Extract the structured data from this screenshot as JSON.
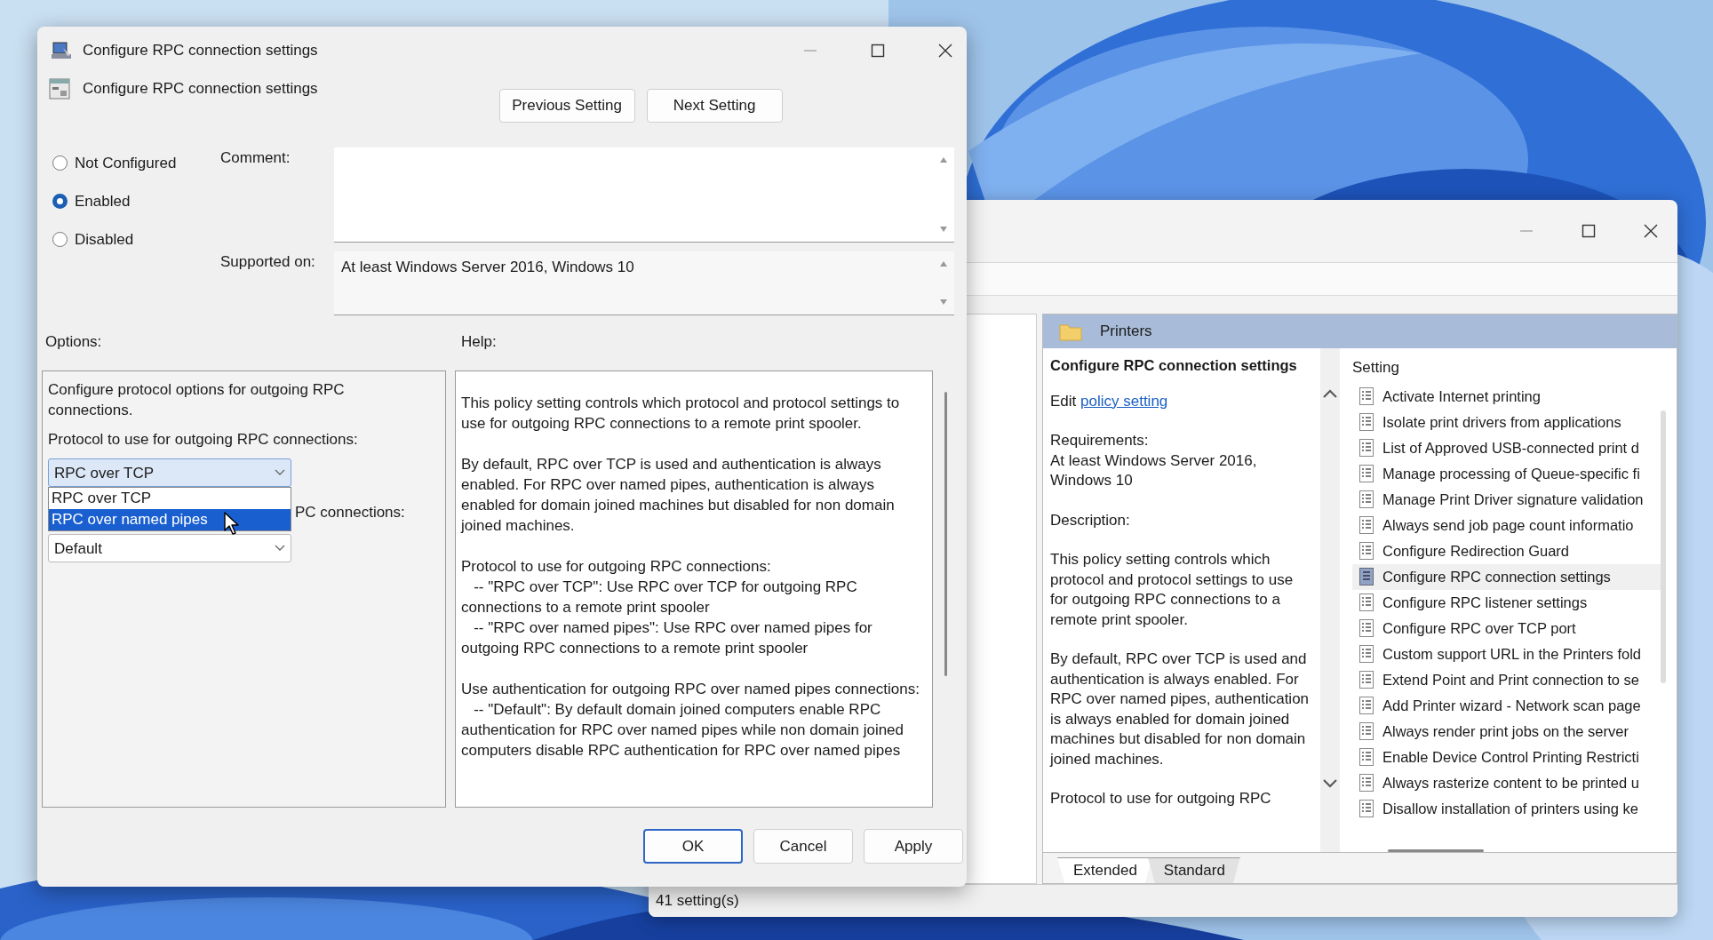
{
  "dialog": {
    "title": "Configure RPC connection settings",
    "heading": "Configure RPC connection settings",
    "nav_buttons": [
      "Previous Setting",
      "Next Setting"
    ],
    "states": [
      {
        "label": "Not Configured",
        "selected": false
      },
      {
        "label": "Enabled",
        "selected": true
      },
      {
        "label": "Disabled",
        "selected": false
      }
    ],
    "comment": {
      "label": "Comment:"
    },
    "supported_on": {
      "label": "Supported on:",
      "value": "At least Windows Server 2016, Windows 10"
    },
    "options": {
      "label": "Options:",
      "intro": "Configure protocol options for outgoing RPC connections.",
      "protocol_label": "Protocol to use for outgoing RPC connections:",
      "protocol_dropdown": {
        "value": "RPC over TCP",
        "expanded": true,
        "options": [
          {
            "label": "RPC over TCP",
            "highlighted": false
          },
          {
            "label": "RPC over named pipes",
            "highlighted": true
          }
        ]
      },
      "auth_label": "PC connections:",
      "auth_dropdown": {
        "value": "Default"
      }
    },
    "help": {
      "label": "Help:",
      "paragraphs": [
        "This policy setting controls which protocol and protocol settings to use for outgoing RPC connections to a remote print spooler.",
        "By default, RPC over TCP is used and authentication is always enabled. For RPC over named pipes, authentication is always enabled for domain joined machines but disabled for non domain joined machines.",
        "Protocol to use for outgoing RPC connections:\n   -- \"RPC over TCP\": Use RPC over TCP for outgoing RPC connections to a remote print spooler\n   -- \"RPC over named pipes\": Use RPC over named pipes for outgoing RPC connections to a remote print spooler",
        "Use authentication for outgoing RPC over named pipes connections:\n   -- \"Default\": By default domain joined computers enable RPC authentication for RPC over named pipes while non domain joined computers disable RPC authentication for RPC over named pipes"
      ]
    },
    "buttons": [
      "OK",
      "Cancel",
      "Apply"
    ]
  },
  "editor": {
    "pane_title": "Printers",
    "detail": {
      "title": "Configure RPC connection settings",
      "edit_prefix": "Edit",
      "edit_link": "policy setting",
      "requirements_label": "Requirements:",
      "requirements": "At least Windows Server 2016, Windows 10",
      "description_label": "Description:",
      "description": [
        "This policy setting controls which protocol and protocol settings to use for outgoing RPC connections to a remote print spooler.",
        "By default, RPC over TCP is used and authentication is always enabled. For RPC over named pipes, authentication is always enabled for domain joined machines but disabled for non domain joined machines.",
        "Protocol to use for outgoing RPC"
      ]
    },
    "list": {
      "column": "Setting",
      "items": [
        {
          "label": "Activate Internet printing",
          "selected": false
        },
        {
          "label": "Isolate print drivers from applications",
          "selected": false
        },
        {
          "label": "List of Approved USB-connected print d",
          "selected": false
        },
        {
          "label": "Manage processing of Queue-specific fi",
          "selected": false
        },
        {
          "label": "Manage Print Driver signature validation",
          "selected": false
        },
        {
          "label": "Always send job page count informatio",
          "selected": false
        },
        {
          "label": "Configure Redirection Guard",
          "selected": false
        },
        {
          "label": "Configure RPC connection settings",
          "selected": true
        },
        {
          "label": "Configure RPC listener settings",
          "selected": false
        },
        {
          "label": "Configure RPC over TCP port",
          "selected": false
        },
        {
          "label": "Custom support URL in the Printers fold",
          "selected": false
        },
        {
          "label": "Extend Point and Print connection to se",
          "selected": false
        },
        {
          "label": "Add Printer wizard - Network scan page",
          "selected": false
        },
        {
          "label": "Always render print jobs on the server",
          "selected": false
        },
        {
          "label": "Enable Device Control Printing Restricti",
          "selected": false
        },
        {
          "label": "Always rasterize content to be printed u",
          "selected": false
        },
        {
          "label": "Disallow installation of printers using ke",
          "selected": false
        }
      ]
    },
    "tabs": [
      {
        "label": "Extended",
        "selected": true
      },
      {
        "label": "Standard",
        "selected": false
      }
    ],
    "status_bar": "41 setting(s)"
  }
}
